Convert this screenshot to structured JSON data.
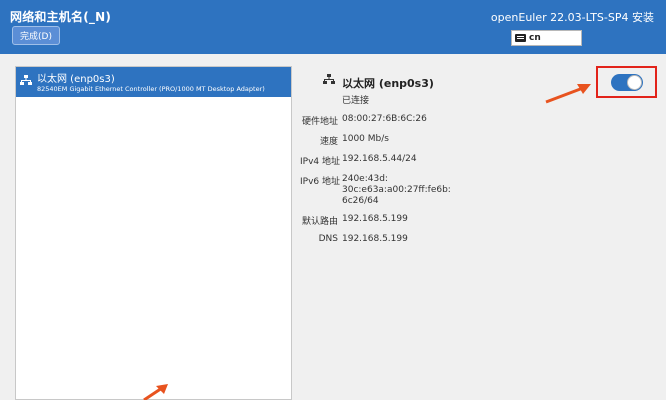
{
  "header": {
    "title": "网络和主机名(_N)",
    "done_label": "完成(D)",
    "product": "openEuler 22.03-LTS-SP4 安装",
    "keyboard_layout": "cn"
  },
  "device_list": {
    "items": [
      {
        "name": "以太网 (enp0s3)",
        "description": "82540EM Gigabit Ethernet Controller (PRO/1000 MT Desktop Adapter)",
        "selected": true
      }
    ]
  },
  "details": {
    "name": "以太网 (enp0s3)",
    "status": "已连接",
    "connection_on": true,
    "fields": {
      "hw_label": "硬件地址",
      "hw_value": "08:00:27:6B:6C:26",
      "speed_label": "速度",
      "speed_value": "1000 Mb/s",
      "ipv4_label": "IPv4 地址",
      "ipv4_value": "192.168.5.44/24",
      "ipv6_label": "IPv6 地址",
      "ipv6_line1": "240e:43d:",
      "ipv6_line2": "30c:e63a:a00:27ff:fe6b:",
      "ipv6_line3": "6c26/64",
      "route_label": "默认路由",
      "route_value": "192.168.5.199",
      "dns_label": "DNS",
      "dns_value": "192.168.5.199"
    }
  },
  "colors": {
    "header": "#2e73c0",
    "highlight_box": "#e2231a",
    "arrow": "#e8531f"
  }
}
